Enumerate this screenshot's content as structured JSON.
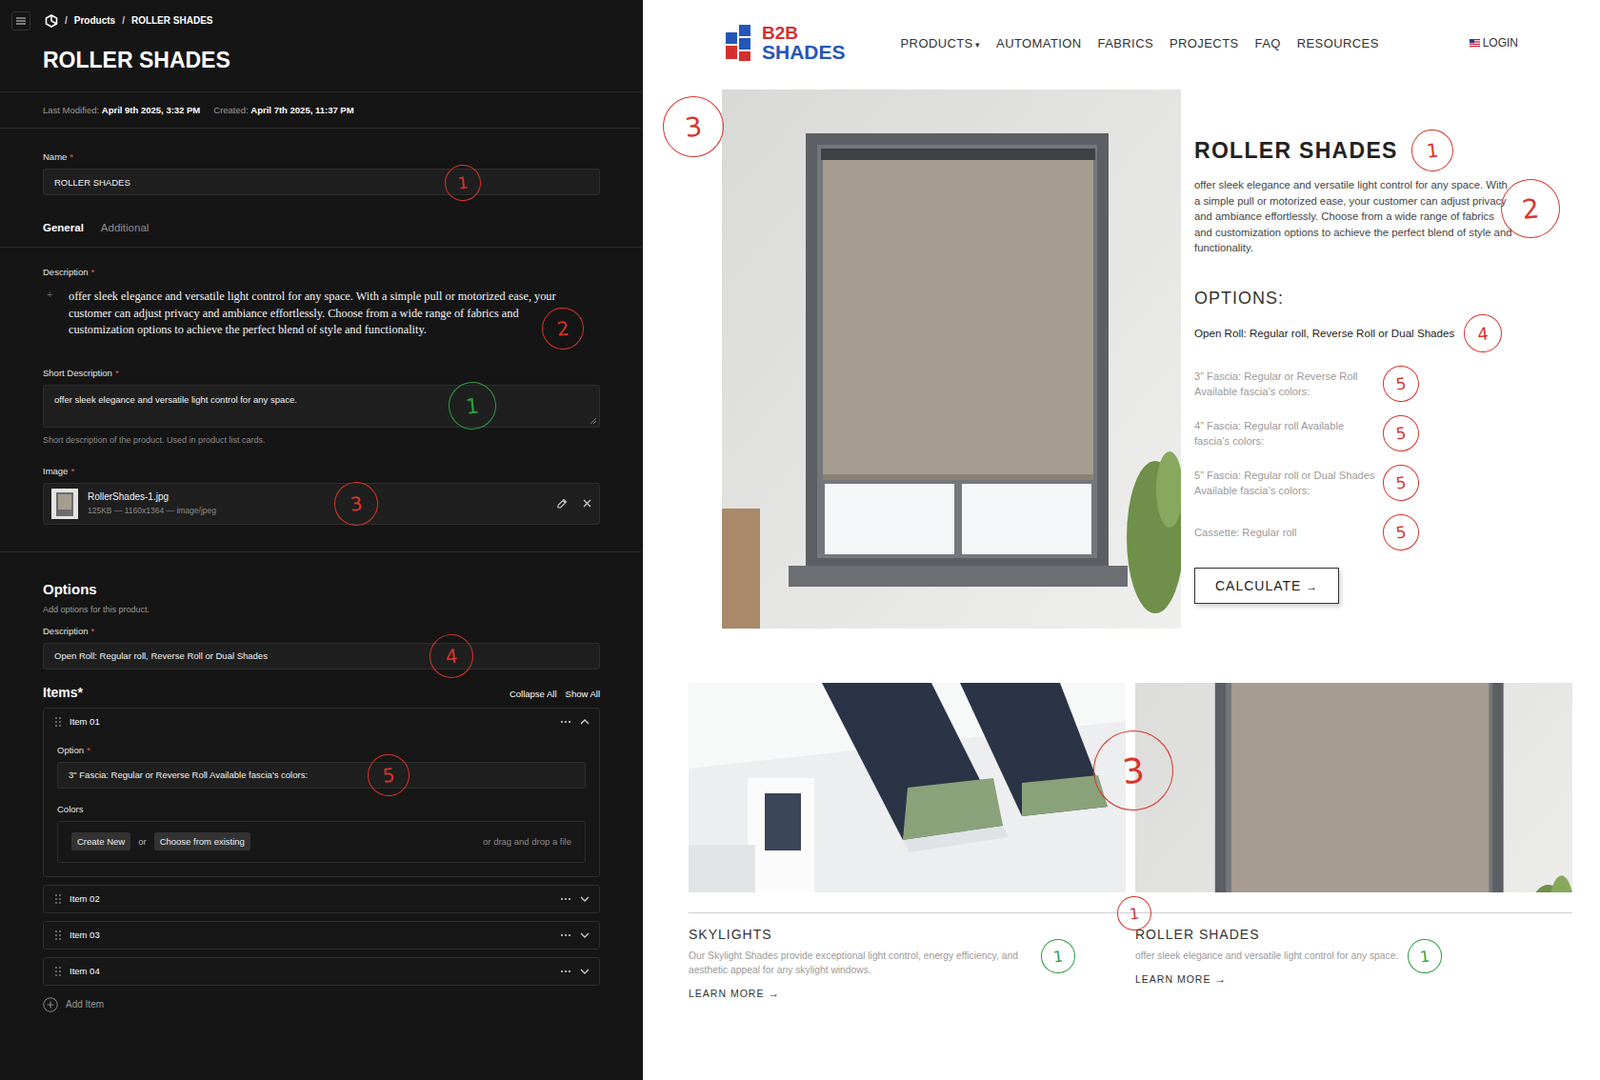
{
  "cms": {
    "breadcrumb": {
      "separator": "/",
      "items": [
        "Products",
        "ROLLER SHADES"
      ]
    },
    "title": "ROLLER SHADES",
    "required_mark": "*",
    "meta": [
      {
        "label": "Last Modified:",
        "value": "April 9th 2025, 3:32 PM"
      },
      {
        "label": "Created:",
        "value": "April 7th 2025, 11:37 PM"
      }
    ],
    "name_field": {
      "label": "Name",
      "required": true,
      "value": "ROLLER SHADES",
      "mark": {
        "text": "1",
        "color": "#d9342b"
      }
    },
    "tabs": [
      {
        "label": "General",
        "selected": true
      },
      {
        "label": "Additional",
        "selected": false
      }
    ],
    "description": {
      "label": "Description",
      "required": true,
      "handle": "+",
      "value": "offer sleek elegance and versatile light control for any space. With a simple pull or motorized ease, your customer can adjust privacy and ambiance effortlessly. Choose from a wide range of fabrics and customization options to achieve the perfect blend of style and functionality.",
      "mark": {
        "text": "2",
        "color": "#d9342b"
      }
    },
    "short_description": {
      "label": "Short Description",
      "required": true,
      "value": "offer sleek elegance and versatile light control for any space.",
      "hint": "Short description of the product. Used in product list cards.",
      "mark": {
        "text": "1",
        "color": "#2e9e44"
      }
    },
    "image": {
      "label": "Image",
      "required": true,
      "file": "RollerShades-1.jpg",
      "meta": "125KB — 1160x1364 — image/jpeg",
      "mark": {
        "text": "3",
        "color": "#d9342b"
      }
    },
    "options": {
      "title": "Options",
      "subtitle": "Add options for this product.",
      "description_label": "Description",
      "description_value": "Open Roll: Regular roll, Reverse Roll or Dual Shades",
      "mark": {
        "text": "4",
        "color": "#d9342b"
      }
    },
    "items_title": "Items*",
    "collapse_all": "Collapse All",
    "show_all": "Show All",
    "items": [
      {
        "title": "Item 01",
        "expanded": true,
        "option": {
          "label": "Option",
          "required": true,
          "value": "3\" Fascia: Regular or Reverse Roll Available fascia's colors:",
          "mark": {
            "text": "5",
            "color": "#d9342b"
          }
        },
        "colors": {
          "label": "Colors",
          "create": "Create New",
          "or": "or",
          "choose": "Choose from existing",
          "drop": "or drag and drop a file"
        }
      },
      {
        "title": "Item 02",
        "expanded": false
      },
      {
        "title": "Item 03",
        "expanded": false
      },
      {
        "title": "Item 04",
        "expanded": false
      }
    ],
    "add_item": "Add Item"
  },
  "site": {
    "logo": {
      "line1": "B2B",
      "line2": "SHADES"
    },
    "nav": [
      {
        "label": "PRODUCTS",
        "caret": "▾"
      },
      {
        "label": "AUTOMATION",
        "caret": ""
      },
      {
        "label": "FABRICS",
        "caret": ""
      },
      {
        "label": "PROJECTS",
        "caret": ""
      },
      {
        "label": "FAQ",
        "caret": ""
      },
      {
        "label": "RESOURCES",
        "caret": ""
      }
    ],
    "login": "LOGIN",
    "hero": {
      "image_mark": {
        "text": "3",
        "color": "#d9342b"
      },
      "title": "ROLLER SHADES",
      "title_mark": {
        "text": "1",
        "color": "#d9342b"
      },
      "description": "offer sleek elegance and versatile light control for any space. With a simple pull or motorized ease, your customer can adjust privacy and ambiance effortlessly. Choose from a wide range of fabrics and customization options to achieve the perfect blend of style and functionality.",
      "description_mark": {
        "text": "2",
        "color": "#d9342b"
      },
      "options_title": "OPTIONS:",
      "options_description": "Open Roll: Regular roll, Reverse Roll or Dual Shades",
      "options_mark": {
        "text": "4",
        "color": "#d9342b"
      },
      "option_items": [
        {
          "text": "3” Fascia: Regular or Reverse Roll Available fascia’s colors:",
          "mark": {
            "text": "5",
            "color": "#d9342b"
          }
        },
        {
          "text": "4” Fascia: Regular roll Available fascia’s colors:",
          "mark": {
            "text": "5",
            "color": "#d9342b"
          }
        },
        {
          "text": "5” Fascia: Regular roll or Dual Shades Available fascia’s colors:",
          "mark": {
            "text": "5",
            "color": "#d9342b"
          }
        },
        {
          "text": "Cassette: Regular roll",
          "mark": {
            "text": "5",
            "color": "#d9342b"
          }
        }
      ],
      "button": "CALCULATE",
      "button_arrow": "→"
    },
    "cards": [
      {
        "kind": "skylight",
        "title": "SKYLIGHTS",
        "text": "Our Skylight Shades provide exceptional light control, energy efficiency, and aesthetic appeal for any skylight windows.",
        "link": "LEARN MORE",
        "arrow": "→",
        "text_mark": {
          "text": "1",
          "color": "#2e9e44"
        }
      },
      {
        "kind": "roller",
        "title": "ROLLER SHADES",
        "text": "offer sleek elegance and versatile light control for any space.",
        "link": "LEARN MORE",
        "arrow": "→",
        "text_mark": {
          "text": "1",
          "color": "#2e9e44"
        },
        "image_mark": {
          "text": "3",
          "color": "#d9342b"
        },
        "divider_mark": {
          "text": "1",
          "color": "#d9342b"
        }
      }
    ]
  }
}
